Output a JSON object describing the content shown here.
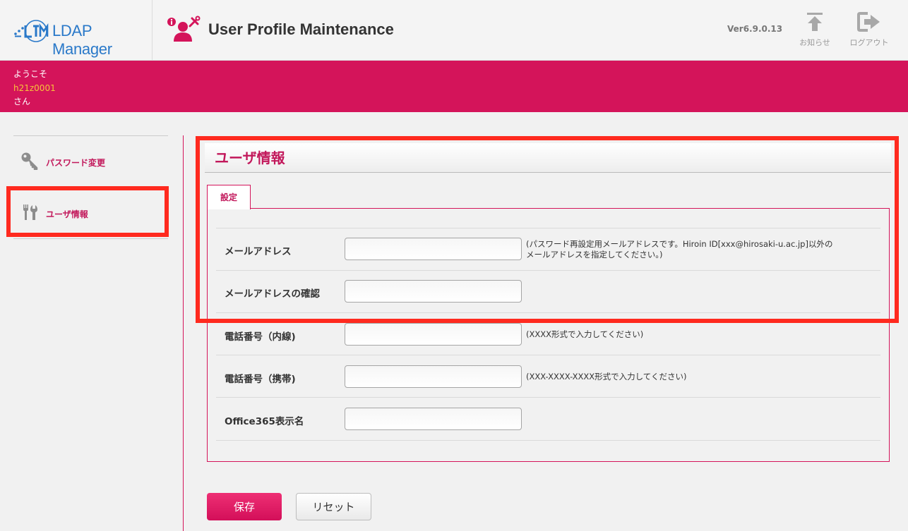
{
  "header": {
    "logo_text": "LDAP Manager",
    "app_title": "User Profile Maintenance",
    "version": "Ver6.9.0.13",
    "notice_label": "お知らせ",
    "logout_label": "ログアウト"
  },
  "welcome": {
    "greeting": "ようこそ",
    "user_id": "h21z0001",
    "suffix": "さん"
  },
  "sidebar": {
    "items": [
      {
        "label": "パスワード変更",
        "icon": "key-icon"
      },
      {
        "label": "ユーザ情報",
        "icon": "tools-icon"
      }
    ]
  },
  "main": {
    "title": "ユーザ情報",
    "tab_label": "設定",
    "fields": [
      {
        "label": "メールアドレス",
        "value": "",
        "note": "(パスワード再設定用メールアドレスです。Hiroin ID[xxx@hirosaki-u.ac.jp]以外の\nメールアドレスを指定してください。)"
      },
      {
        "label": "メールアドレスの確認",
        "value": "",
        "note": ""
      },
      {
        "label": "電話番号（内線)",
        "value": "",
        "note": "(XXXX形式で入力してください)"
      },
      {
        "label": "電話番号（携帯)",
        "value": "",
        "note": "(XXX-XXXX-XXXX形式で入力してください)"
      },
      {
        "label": "Office365表示名",
        "value": "",
        "note": ""
      }
    ]
  },
  "buttons": {
    "save_label": "保存",
    "reset_label": "リセット"
  },
  "colors": {
    "brand": "#d4145a",
    "accent_text": "#c2185b",
    "user_id": "#f7c23a",
    "highlight": "#ff2a1f",
    "logo": "#2a79c9"
  }
}
